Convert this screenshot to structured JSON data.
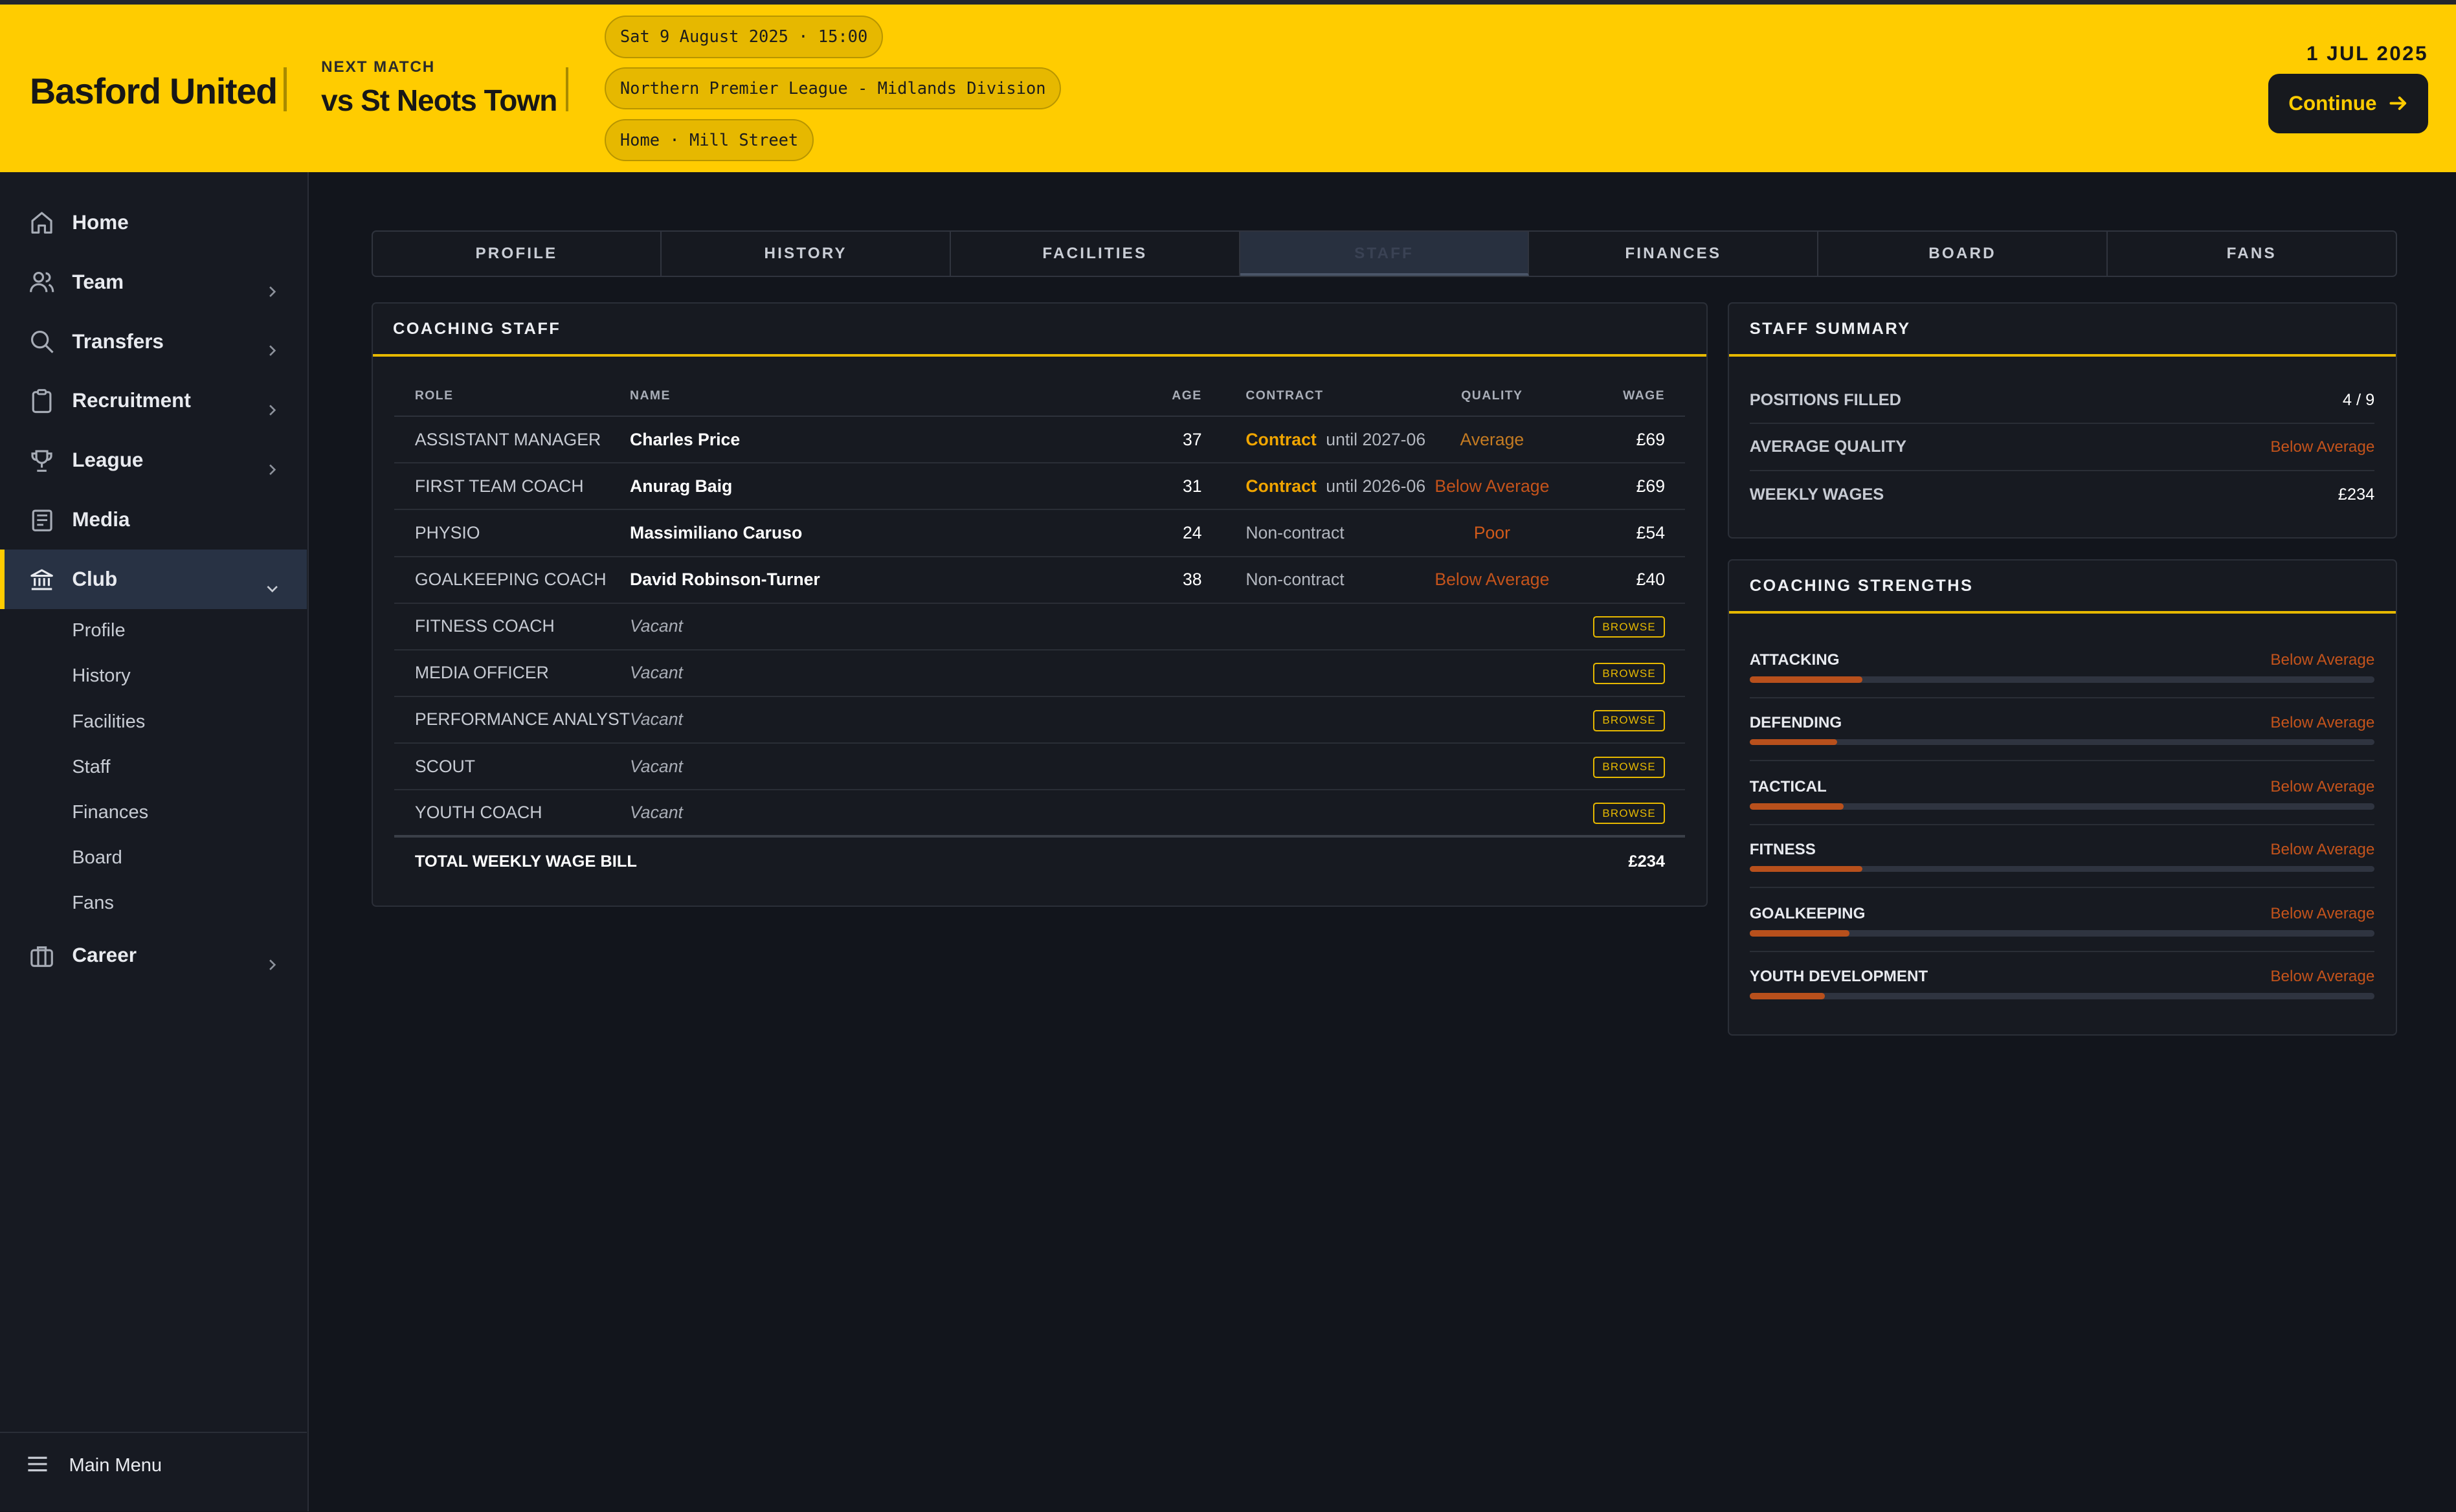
{
  "header": {
    "club_name": "Basford United",
    "next_match_label": "NEXT MATCH",
    "next_opponent": "vs St Neots Town",
    "pills": [
      "Sat 9 August 2025 · 15:00",
      "Northern Premier League - Midlands Division",
      "Home · Mill Street"
    ],
    "date": "1 JUL 2025",
    "continue_label": "Continue"
  },
  "sidebar": {
    "items": [
      {
        "label": "Home",
        "icon": "home-icon"
      },
      {
        "label": "Team",
        "icon": "people-icon"
      },
      {
        "label": "Transfers",
        "icon": "search-icon"
      },
      {
        "label": "Recruitment",
        "icon": "clipboard-icon"
      },
      {
        "label": "League",
        "icon": "trophy-icon"
      },
      {
        "label": "Media",
        "icon": "newspaper-icon"
      },
      {
        "label": "Club",
        "icon": "bank-icon"
      },
      {
        "label": "Career",
        "icon": "briefcase-icon"
      }
    ],
    "club_sub_items": [
      "Profile",
      "History",
      "Facilities",
      "Staff",
      "Finances",
      "Board",
      "Fans"
    ],
    "main_menu_label": "Main Menu"
  },
  "tabs": [
    "PROFILE",
    "HISTORY",
    "FACILITIES",
    "STAFF",
    "FINANCES",
    "BOARD",
    "FANS"
  ],
  "active_tab": "STAFF",
  "coaching_staff": {
    "title": "COACHING STAFF",
    "columns": {
      "role": "ROLE",
      "name": "NAME",
      "age": "AGE",
      "contract": "CONTRACT",
      "quality": "QUALITY",
      "wage": "WAGE"
    },
    "rows": [
      {
        "role": "ASSISTANT MANAGER",
        "name": "Charles Price",
        "age": "37",
        "contract_tag": "Contract",
        "contract_detail": "until 2027-06",
        "quality": "Average",
        "wage": "£69"
      },
      {
        "role": "FIRST TEAM COACH",
        "name": "Anurag Baig",
        "age": "31",
        "contract_tag": "Contract",
        "contract_detail": "until 2026-06",
        "quality": "Below Average",
        "wage": "£69"
      },
      {
        "role": "PHYSIO",
        "name": "Massimiliano Caruso",
        "age": "24",
        "contract_detail": "Non-contract",
        "quality": "Poor",
        "wage": "£54"
      },
      {
        "role": "GOALKEEPING COACH",
        "name": "David Robinson-Turner",
        "age": "38",
        "contract_detail": "Non-contract",
        "quality": "Below Average",
        "wage": "£40"
      },
      {
        "role": "FITNESS COACH",
        "name": "Vacant",
        "browse": "BROWSE"
      },
      {
        "role": "MEDIA OFFICER",
        "name": "Vacant",
        "browse": "BROWSE"
      },
      {
        "role": "PERFORMANCE ANALYST",
        "name": "Vacant",
        "browse": "BROWSE"
      },
      {
        "role": "SCOUT",
        "name": "Vacant",
        "browse": "BROWSE"
      },
      {
        "role": "YOUTH COACH",
        "name": "Vacant",
        "browse": "BROWSE"
      }
    ],
    "total_label": "TOTAL WEEKLY WAGE BILL",
    "total_value": "£234"
  },
  "staff_summary": {
    "title": "STAFF SUMMARY",
    "rows": [
      {
        "label": "POSITIONS FILLED",
        "value": "4 / 9"
      },
      {
        "label": "AVERAGE QUALITY",
        "value": "Below Average"
      },
      {
        "label": "WEEKLY WAGES",
        "value": "£234"
      }
    ]
  },
  "coaching_strengths": {
    "title": "COACHING STRENGTHS",
    "rows": [
      {
        "label": "ATTACKING",
        "value": "Below Average",
        "level": 0.18
      },
      {
        "label": "DEFENDING",
        "value": "Below Average",
        "level": 0.14
      },
      {
        "label": "TACTICAL",
        "value": "Below Average",
        "level": 0.15
      },
      {
        "label": "FITNESS",
        "value": "Below Average",
        "level": 0.18
      },
      {
        "label": "GOALKEEPING",
        "value": "Below Average",
        "level": 0.16
      },
      {
        "label": "YOUTH DEVELOPMENT",
        "value": "Below Average",
        "level": 0.12
      }
    ]
  },
  "colors": {
    "accent": "#ffcc00",
    "background": "#12151c",
    "panel": "#171a21",
    "below_average": "#c4531b"
  }
}
